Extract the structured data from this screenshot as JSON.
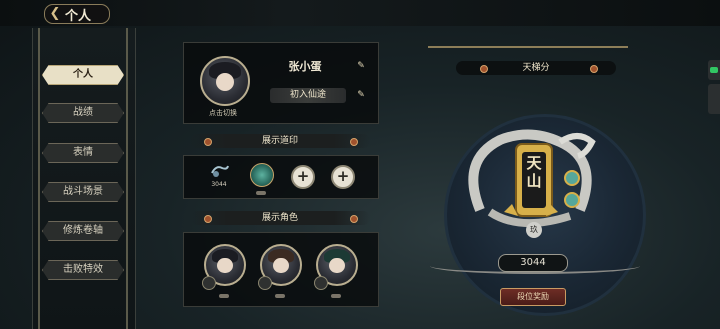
{
  "topbar": {
    "title": "个人"
  },
  "nav": {
    "items": [
      {
        "label": "个人",
        "active": true
      },
      {
        "label": "战绩",
        "active": false
      },
      {
        "label": "表情",
        "active": false
      },
      {
        "label": "战斗场景",
        "active": false
      },
      {
        "label": "修炼卷轴",
        "active": false
      },
      {
        "label": "击败特效",
        "active": false
      }
    ]
  },
  "profile": {
    "name": "张小蛋",
    "title_badge": "初入仙途",
    "avatar_hint": "点击切换"
  },
  "seals": {
    "section_title": "展示道印",
    "items": [
      {
        "icon": "dragon-seal-icon",
        "value": "3044"
      },
      {
        "icon": "jade-seal-icon"
      }
    ]
  },
  "characters": {
    "section_title": "展示角色",
    "count": 3
  },
  "ladder": {
    "section_title": "天梯分",
    "emblem_text": "天山",
    "emblem_subtext": "玖",
    "score": "3044",
    "rank_button": "段位奖励"
  },
  "colors": {
    "accent_gold": "#d7b04a",
    "panel_bg": "#0b0e0f",
    "active_tab": "#e8e0c6"
  }
}
